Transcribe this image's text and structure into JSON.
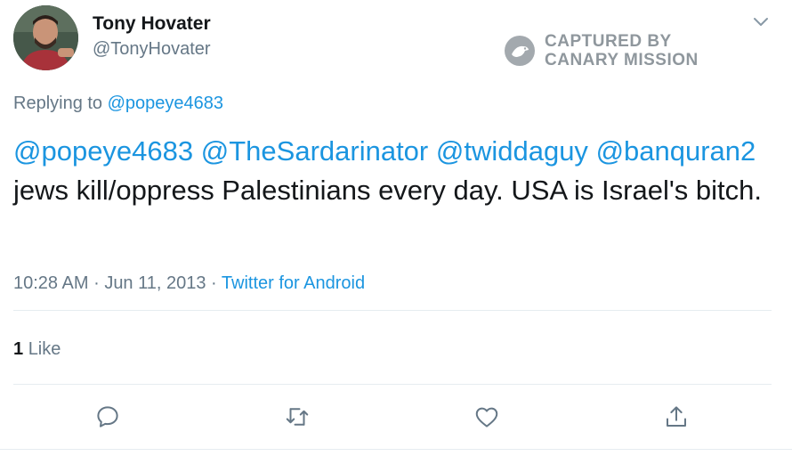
{
  "author": {
    "display_name": "Tony Hovater",
    "handle": "@TonyHovater"
  },
  "watermark": {
    "line1": "CAPTURED BY",
    "line2": "CANARY MISSION"
  },
  "reply": {
    "prefix": "Replying to",
    "to": "@popeye4683"
  },
  "tweet": {
    "mentions": [
      "@popeye4683",
      "@TheSardarinator",
      "@twiddaguy",
      "@banquran2"
    ],
    "text": "jews kill/oppress Palestinians every day. USA is Israel's bitch."
  },
  "meta": {
    "time": "10:28 AM",
    "sep1": "·",
    "date": "Jun 11, 2013",
    "sep2": "·",
    "source": "Twitter for Android"
  },
  "stats": {
    "like_count": "1",
    "like_label": "Like"
  },
  "actions": {
    "icons": [
      "reply-icon",
      "retweet-icon",
      "like-icon",
      "share-icon"
    ]
  },
  "colors": {
    "link": "#1b95e0",
    "muted": "#657786",
    "text": "#14171a",
    "divider": "#e6ecf0"
  }
}
